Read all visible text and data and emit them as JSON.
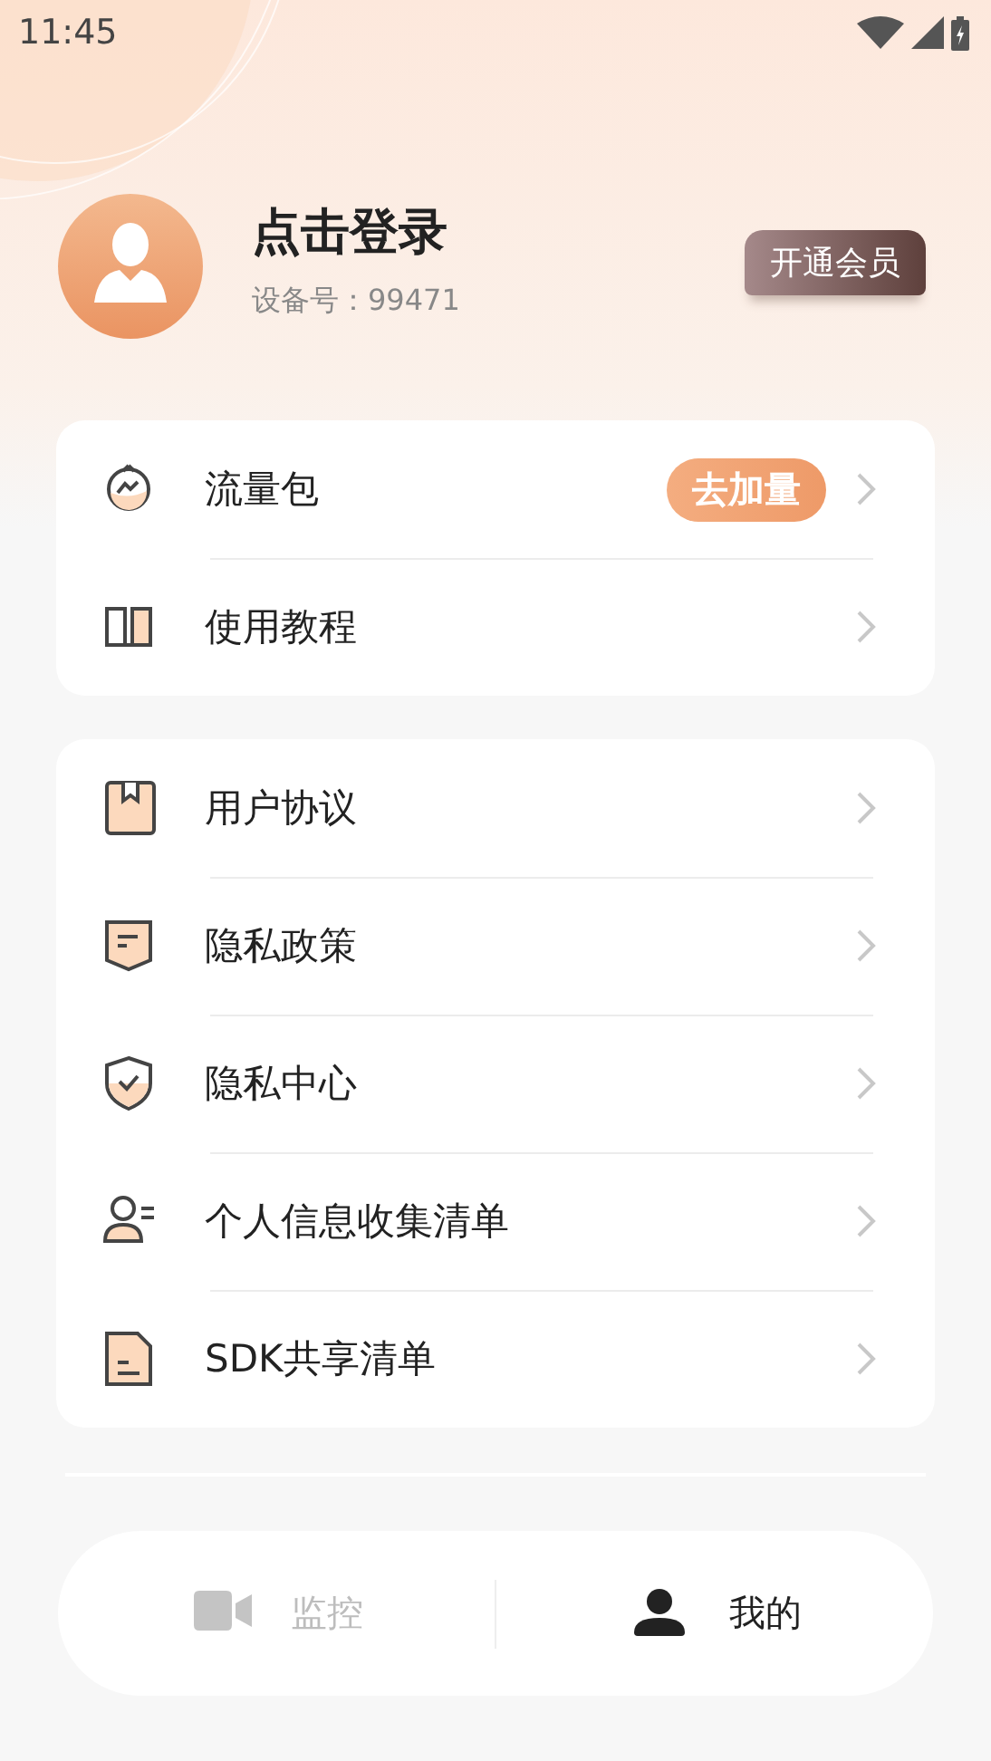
{
  "status_bar": {
    "time": "11:45"
  },
  "profile": {
    "title": "点击登录",
    "device_label": "设备号：99471",
    "vip_button": "开通会员"
  },
  "menu_groups": [
    {
      "items": [
        {
          "label": "流量包",
          "badge": "去加量"
        },
        {
          "label": "使用教程"
        }
      ]
    },
    {
      "items": [
        {
          "label": "用户协议"
        },
        {
          "label": "隐私政策"
        },
        {
          "label": "隐私中心"
        },
        {
          "label": "个人信息收集清单"
        },
        {
          "label": "SDK共享清单"
        }
      ]
    }
  ],
  "bottom_nav": [
    {
      "label": "监控",
      "selected": false
    },
    {
      "label": "我的",
      "selected": true
    }
  ]
}
